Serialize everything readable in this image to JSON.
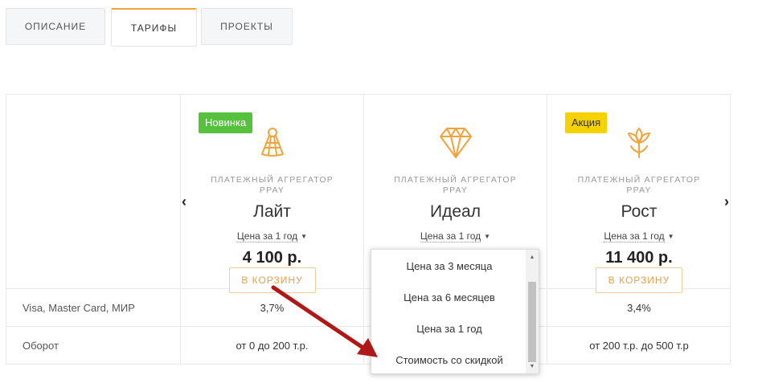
{
  "tabs": [
    {
      "label": "ОПИСАНИЕ"
    },
    {
      "label": "ТАРИФЫ"
    },
    {
      "label": "ПРОЕКТЫ"
    }
  ],
  "plans": [
    {
      "badge": "Новинка",
      "subtitle": "ПЛАТЕЖНЫЙ АГРЕГАТОР PPAY",
      "name": "Лайт",
      "period": "Цена за 1 год",
      "price": "4 100 р.",
      "cart": "В КОРЗИНУ",
      "icon": "shuttlecock-icon"
    },
    {
      "badge": "",
      "subtitle": "ПЛАТЕЖНЫЙ АГРЕГАТОР PPAY",
      "name": "Идеал",
      "period": "Цена за 1 год",
      "price": "",
      "cart": "",
      "icon": "diamond-icon"
    },
    {
      "badge": "Акция",
      "subtitle": "ПЛАТЕЖНЫЙ АГРЕГАТОР PPAY",
      "name": "Рост",
      "period": "Цена за 1 год",
      "price": "11 400 р.",
      "cart": "В КОРЗИНУ",
      "icon": "flower-icon"
    }
  ],
  "features": [
    {
      "label": "Visa, Master Card, МИР",
      "values": [
        "3,7%",
        "",
        "3,4%"
      ]
    },
    {
      "label": "Оборот",
      "values": [
        "от 0 до 200 т.р.",
        "",
        "от 200 т.р. до 500 т.р"
      ]
    }
  ],
  "dropdown": {
    "options": [
      "Цена за 3 месяца",
      "Цена за 6 месяцев",
      "Цена за 1 год",
      "Стоимость со скидкой"
    ]
  },
  "nav": {
    "prev": "‹",
    "next": "›"
  },
  "colors": {
    "accent": "#f0a43b",
    "badge_new": "#56c13c",
    "badge_sale": "#f5d200",
    "annotation_arrow": "#b01717"
  }
}
